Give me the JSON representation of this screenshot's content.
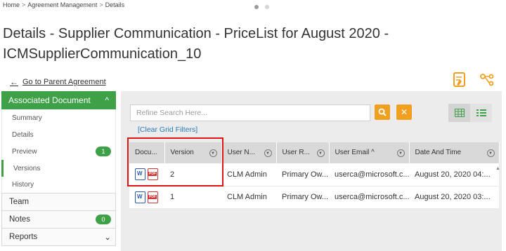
{
  "breadcrumb": {
    "items": [
      "Home",
      "Agreement Management",
      "Details"
    ],
    "separator": ">"
  },
  "title": "Details - Supplier Communication - PriceList for August 2020 - ICMSupplierCommunication_10",
  "parent_link": {
    "arrow": "←",
    "label": "Go to Parent Agreement"
  },
  "sidebar": {
    "section": {
      "label": "Associated Document",
      "chevron": "^"
    },
    "sub_items": [
      {
        "label": "Summary"
      },
      {
        "label": "Details"
      },
      {
        "label": "Preview",
        "badge": "1"
      },
      {
        "label": "Versions",
        "active": true
      },
      {
        "label": "History"
      }
    ],
    "main_items": [
      {
        "label": "Team"
      },
      {
        "label": "Notes",
        "badge": "0"
      },
      {
        "label": "Reports",
        "chevron": "⌄"
      }
    ]
  },
  "search": {
    "placeholder": "Refine Search Here...",
    "search_icon": "⚲",
    "clear_icon": "✕"
  },
  "clear_filters": "[Clear Grid Filters]",
  "grid": {
    "columns": [
      "Docu...",
      "Version",
      "User N...",
      "User R...",
      "User Email ^",
      "Date And Time"
    ],
    "rows": [
      {
        "version": "2",
        "user_name": "CLM Admin",
        "user_role": "Primary Ow...",
        "user_email": "userca@microsoft.c...",
        "date_time": "August 20, 2020 04:..."
      },
      {
        "version": "1",
        "user_name": "CLM Admin",
        "user_role": "Primary Ow...",
        "user_email": "userca@microsoft.c...",
        "date_time": "August 20, 2020 03:..."
      }
    ]
  },
  "colors": {
    "accent_green": "#3ea047",
    "orange": "#f0a020",
    "link_blue": "#2a7ab8",
    "highlight_red": "#e01414"
  }
}
